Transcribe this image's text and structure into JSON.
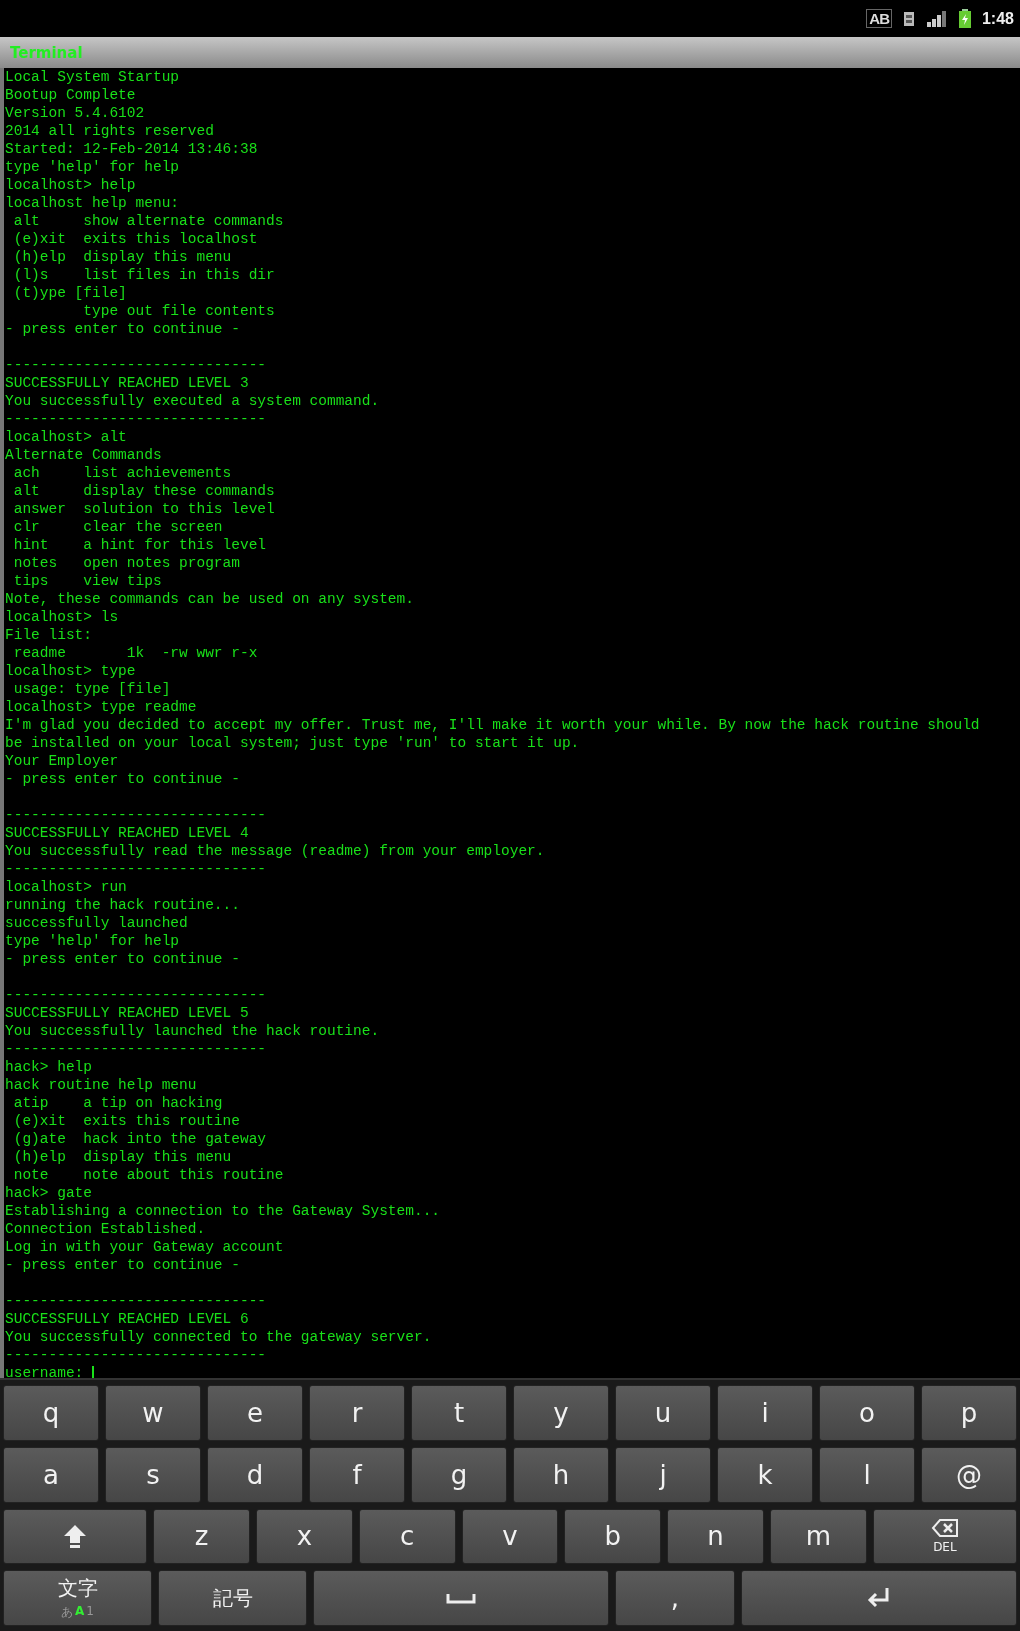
{
  "status_bar": {
    "indicator": "AB",
    "time": "1:48"
  },
  "app_bar": {
    "title": "Terminal"
  },
  "terminal": {
    "lines": [
      {
        "kind": "text",
        "text": "Local System Startup"
      },
      {
        "kind": "text",
        "text": "Bootup Complete"
      },
      {
        "kind": "text",
        "text": "Version 5.4.6102"
      },
      {
        "kind": "text",
        "text": "2014 all rights reserved"
      },
      {
        "kind": "text",
        "text": "Started: 12-Feb-2014 13:46:38"
      },
      {
        "kind": "text",
        "text": "type 'help' for help"
      },
      {
        "kind": "text",
        "text": "localhost> help"
      },
      {
        "kind": "text",
        "text": "localhost help menu:"
      },
      {
        "kind": "text",
        "text": " alt     show alternate commands"
      },
      {
        "kind": "text",
        "text": " (e)xit  exits this localhost"
      },
      {
        "kind": "text",
        "text": " (h)elp  display this menu"
      },
      {
        "kind": "text",
        "text": " (l)s    list files in this dir"
      },
      {
        "kind": "text",
        "text": " (t)ype [file]"
      },
      {
        "kind": "text",
        "text": "         type out file contents"
      },
      {
        "kind": "text",
        "text": "- press enter to continue -"
      },
      {
        "kind": "blank"
      },
      {
        "kind": "text",
        "text": "------------------------------"
      },
      {
        "kind": "text",
        "text": "SUCCESSFULLY REACHED LEVEL 3"
      },
      {
        "kind": "text",
        "text": "You successfully executed a system command."
      },
      {
        "kind": "text",
        "text": "------------------------------"
      },
      {
        "kind": "text",
        "text": "localhost> alt"
      },
      {
        "kind": "text",
        "text": "Alternate Commands"
      },
      {
        "kind": "text",
        "text": " ach     list achievements"
      },
      {
        "kind": "text",
        "text": " alt     display these commands"
      },
      {
        "kind": "text",
        "text": " answer  solution to this level"
      },
      {
        "kind": "text",
        "text": " clr     clear the screen"
      },
      {
        "kind": "text",
        "text": " hint    a hint for this level"
      },
      {
        "kind": "text",
        "text": " notes   open notes program"
      },
      {
        "kind": "text",
        "text": " tips    view tips"
      },
      {
        "kind": "text",
        "text": "Note, these commands can be used on any system."
      },
      {
        "kind": "text",
        "text": "localhost> ls"
      },
      {
        "kind": "text",
        "text": "File list:"
      },
      {
        "kind": "text",
        "text": " readme       1k  -rw wwr r-x"
      },
      {
        "kind": "text",
        "text": "localhost> type"
      },
      {
        "kind": "text",
        "text": " usage: type [file]"
      },
      {
        "kind": "text",
        "text": "localhost> type readme"
      },
      {
        "kind": "text",
        "text": "I'm glad you decided to accept my offer. Trust me, I'll make it worth your while. By now the hack routine should"
      },
      {
        "kind": "text",
        "text": "be installed on your local system; just type 'run' to start it up."
      },
      {
        "kind": "text",
        "text": "Your Employer"
      },
      {
        "kind": "text",
        "text": "- press enter to continue -"
      },
      {
        "kind": "blank"
      },
      {
        "kind": "text",
        "text": "------------------------------"
      },
      {
        "kind": "text",
        "text": "SUCCESSFULLY REACHED LEVEL 4"
      },
      {
        "kind": "text",
        "text": "You successfully read the message (readme) from your employer."
      },
      {
        "kind": "text",
        "text": "------------------------------"
      },
      {
        "kind": "text",
        "text": "localhost> run"
      },
      {
        "kind": "text",
        "text": "running the hack routine..."
      },
      {
        "kind": "text",
        "text": "successfully launched"
      },
      {
        "kind": "text",
        "text": "type 'help' for help"
      },
      {
        "kind": "text",
        "text": "- press enter to continue -"
      },
      {
        "kind": "blank"
      },
      {
        "kind": "text",
        "text": "------------------------------"
      },
      {
        "kind": "text",
        "text": "SUCCESSFULLY REACHED LEVEL 5"
      },
      {
        "kind": "text",
        "text": "You successfully launched the hack routine."
      },
      {
        "kind": "text",
        "text": "------------------------------"
      },
      {
        "kind": "text",
        "text": "hack> help"
      },
      {
        "kind": "text",
        "text": "hack routine help menu"
      },
      {
        "kind": "text",
        "text": " atip    a tip on hacking"
      },
      {
        "kind": "text",
        "text": " (e)xit  exits this routine"
      },
      {
        "kind": "text",
        "text": " (g)ate  hack into the gateway"
      },
      {
        "kind": "text",
        "text": " (h)elp  display this menu"
      },
      {
        "kind": "text",
        "text": " note    note about this routine"
      },
      {
        "kind": "text",
        "text": "hack> gate"
      },
      {
        "kind": "text",
        "text": "Establishing a connection to the Gateway System..."
      },
      {
        "kind": "text",
        "text": "Connection Established."
      },
      {
        "kind": "text",
        "text": "Log in with your Gateway account"
      },
      {
        "kind": "text",
        "text": "- press enter to continue -"
      },
      {
        "kind": "blank"
      },
      {
        "kind": "text",
        "text": "------------------------------"
      },
      {
        "kind": "text",
        "text": "SUCCESSFULLY REACHED LEVEL 6"
      },
      {
        "kind": "text",
        "text": "You successfully connected to the gateway server."
      },
      {
        "kind": "text",
        "text": "------------------------------"
      }
    ],
    "input": {
      "prompt": "username:"
    }
  },
  "keyboard": {
    "rows": [
      [
        {
          "kind": "char",
          "label": "q"
        },
        {
          "kind": "char",
          "label": "w"
        },
        {
          "kind": "char",
          "label": "e"
        },
        {
          "kind": "char",
          "label": "r"
        },
        {
          "kind": "char",
          "label": "t"
        },
        {
          "kind": "char",
          "label": "y"
        },
        {
          "kind": "char",
          "label": "u"
        },
        {
          "kind": "char",
          "label": "i"
        },
        {
          "kind": "char",
          "label": "o"
        },
        {
          "kind": "char",
          "label": "p"
        }
      ],
      [
        {
          "kind": "char",
          "label": "a"
        },
        {
          "kind": "char",
          "label": "s"
        },
        {
          "kind": "char",
          "label": "d"
        },
        {
          "kind": "char",
          "label": "f"
        },
        {
          "kind": "char",
          "label": "g"
        },
        {
          "kind": "char",
          "label": "h"
        },
        {
          "kind": "char",
          "label": "j"
        },
        {
          "kind": "char",
          "label": "k"
        },
        {
          "kind": "char",
          "label": "l"
        },
        {
          "kind": "char",
          "label": "@"
        }
      ],
      [
        {
          "kind": "shift"
        },
        {
          "kind": "char",
          "label": "z"
        },
        {
          "kind": "char",
          "label": "x"
        },
        {
          "kind": "char",
          "label": "c"
        },
        {
          "kind": "char",
          "label": "v"
        },
        {
          "kind": "char",
          "label": "b"
        },
        {
          "kind": "char",
          "label": "n"
        },
        {
          "kind": "char",
          "label": "m"
        },
        {
          "kind": "delete",
          "label": "DEL"
        }
      ],
      [
        {
          "kind": "mode",
          "label": "文字",
          "modes": [
            {
              "text": "あ",
              "selected": false
            },
            {
              "text": "A",
              "selected": true
            },
            {
              "text": "1",
              "selected": false
            }
          ]
        },
        {
          "kind": "symbols",
          "label": "記号"
        },
        {
          "kind": "space"
        },
        {
          "kind": "char",
          "label": ","
        },
        {
          "kind": "enter"
        }
      ]
    ]
  }
}
